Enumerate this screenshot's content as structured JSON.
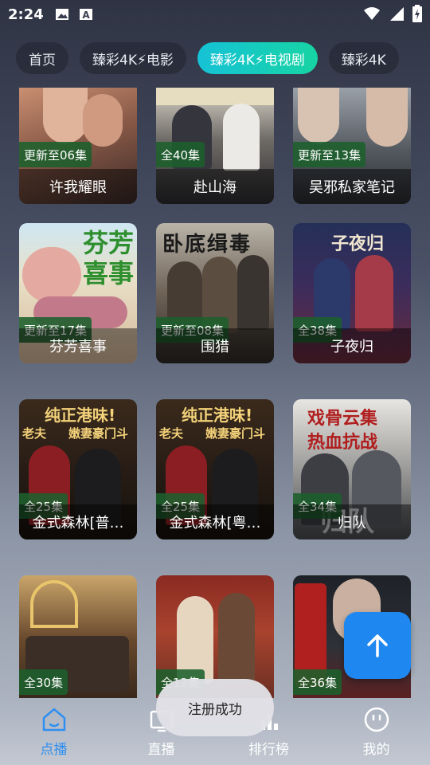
{
  "status": {
    "time": "2:24"
  },
  "tabs": [
    {
      "label": "首页",
      "active": false
    },
    {
      "label": "臻彩4K⚡电影",
      "active": false
    },
    {
      "label": "臻彩4K⚡电视剧",
      "active": true
    },
    {
      "label": "臻彩4K",
      "active": false
    }
  ],
  "cards": [
    {
      "badge": "更新至06集",
      "title": "许我耀眼"
    },
    {
      "badge": "全40集",
      "title": "赴山海"
    },
    {
      "badge": "更新至13集",
      "title": "吴邪私家笔记"
    },
    {
      "badge": "更新至17集",
      "title": "芬芳喜事"
    },
    {
      "badge": "更新至08集",
      "title": "围猎"
    },
    {
      "badge": "全38集",
      "title": "子夜归"
    },
    {
      "badge": "全25集",
      "title": "金式森林[普…"
    },
    {
      "badge": "全25集",
      "title": "金式森林[粤…"
    },
    {
      "badge": "全34集",
      "title": "归队"
    },
    {
      "badge": "全30集",
      "title": ""
    },
    {
      "badge": "全12集",
      "title": ""
    },
    {
      "badge": "全36集",
      "title": ""
    }
  ],
  "posters": {
    "p2": "赴山海",
    "p4_a": "芬芳",
    "p4_b": "喜事",
    "p5": "卧底缉毒",
    "p6": "子夜归",
    "p7_a": "纯正港味!",
    "p7_b": "老夫",
    "p7_c": "嫩妻豪门斗",
    "p9_a": "戏骨云集",
    "p9_b": "热血抗战",
    "p9_c": "归队"
  },
  "nav": [
    {
      "label": "点播",
      "icon": "home-icon",
      "active": true
    },
    {
      "label": "直播",
      "icon": "tv-icon",
      "active": false
    },
    {
      "label": "排行榜",
      "icon": "chart-icon",
      "active": false
    },
    {
      "label": "我的",
      "icon": "smiley-icon",
      "active": false
    }
  ],
  "toast": "注册成功",
  "colors": {
    "accent": "#2f8ff0",
    "tab_active_start": "#16c2d6",
    "tab_active_end": "#17d4a3",
    "badge_bg": "#1c602c",
    "fab": "#1e88f0"
  }
}
